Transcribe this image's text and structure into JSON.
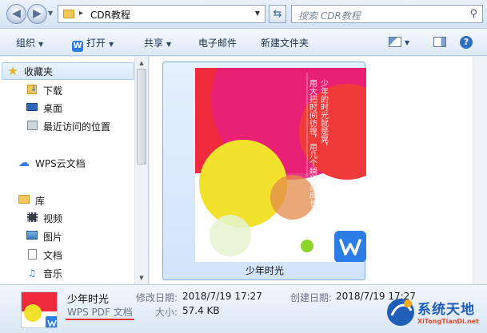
{
  "address": {
    "path": "CDR教程",
    "search_placeholder": "搜索 CDR教程"
  },
  "toolbar": {
    "organize": "组织",
    "open": "打开",
    "share": "共享",
    "email": "电子邮件",
    "new_folder": "新建文件夹"
  },
  "nav": {
    "favorites": "收藏夹",
    "downloads": "下载",
    "desktop": "桌面",
    "recent": "最近访问的位置",
    "wps_cloud": "WPS云文档",
    "library": "库",
    "videos": "视频",
    "pictures": "图片",
    "documents": "文档",
    "music": "音乐"
  },
  "file": {
    "name": "少年时光",
    "poem_col1": "少年的时光就是晃，",
    "poem_col2": "用大把时间彷徨，用几个瞬间来成长。"
  },
  "details": {
    "name": "少年时光",
    "type": "WPS PDF 文档",
    "modified_label": "修改日期:",
    "modified_value": "2018/7/19 17:27",
    "created_label": "创建日期:",
    "created_value": "2018/7/19 17:27",
    "size_label": "大小:",
    "size_value": "57.4 KB"
  },
  "watermark": {
    "name": "系统天地",
    "url": "XiTongTianDi.net"
  },
  "colors": {
    "accent": "#2c7ee6",
    "poster_red": "#ee2a3c",
    "poster_pink": "#e8207a",
    "poster_yellow": "#f2e22e",
    "poster_green": "#8ed42a",
    "underline_red": "#e23232"
  }
}
